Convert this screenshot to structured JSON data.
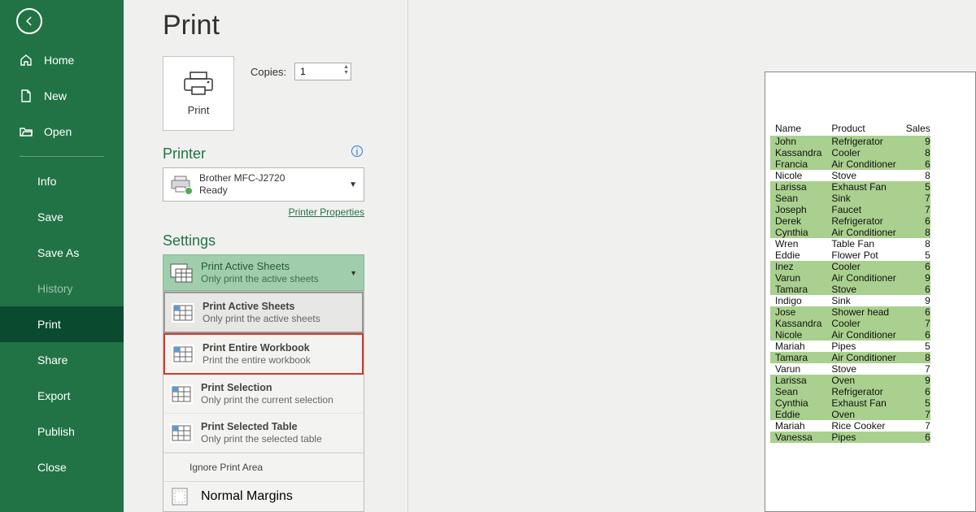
{
  "page_title": "Print",
  "sidebar": {
    "items": [
      {
        "label": "Home",
        "icon": "home"
      },
      {
        "label": "New",
        "icon": "new"
      },
      {
        "label": "Open",
        "icon": "open"
      }
    ],
    "secondary": [
      {
        "label": "Info"
      },
      {
        "label": "Save"
      },
      {
        "label": "Save As"
      },
      {
        "label": "History",
        "disabled": true
      },
      {
        "label": "Print",
        "selected": true
      },
      {
        "label": "Share"
      },
      {
        "label": "Export"
      },
      {
        "label": "Publish"
      },
      {
        "label": "Close"
      }
    ]
  },
  "print_button_label": "Print",
  "copies": {
    "label": "Copies:",
    "value": "1"
  },
  "printer": {
    "section": "Printer",
    "name": "Brother MFC-J2720",
    "status": "Ready",
    "properties_link": "Printer Properties"
  },
  "settings": {
    "section": "Settings",
    "selected": {
      "title": "Print Active Sheets",
      "sub": "Only print the active sheets"
    },
    "options": [
      {
        "title": "Print Active Sheets",
        "sub": "Only print the active sheets",
        "state": "active"
      },
      {
        "title": "Print Entire Workbook",
        "sub": "Print the entire workbook",
        "state": "highlighted"
      },
      {
        "title": "Print Selection",
        "sub": "Only print the current selection",
        "state": ""
      },
      {
        "title": "Print Selected Table",
        "sub": "Only print the selected table",
        "state": ""
      }
    ],
    "ignore": "Ignore Print Area",
    "margins": "Normal Margins"
  },
  "preview": {
    "headers": [
      "Name",
      "Product",
      "Sales"
    ],
    "rows": [
      {
        "name": "John",
        "product": "Refrigerator",
        "sales": "9",
        "g": true
      },
      {
        "name": "Kassandra",
        "product": "Cooler",
        "sales": "8",
        "g": true
      },
      {
        "name": "Francia",
        "product": "Air Conditioner",
        "sales": "6",
        "g": true
      },
      {
        "name": "Nicole",
        "product": "Stove",
        "sales": "8",
        "g": false
      },
      {
        "name": "Larissa",
        "product": "Exhaust Fan",
        "sales": "5",
        "g": true
      },
      {
        "name": "Sean",
        "product": "Sink",
        "sales": "7",
        "g": true
      },
      {
        "name": "Joseph",
        "product": "Faucet",
        "sales": "7",
        "g": true
      },
      {
        "name": "Derek",
        "product": "Refrigerator",
        "sales": "6",
        "g": true
      },
      {
        "name": "Cynthia",
        "product": "Air Conditioner",
        "sales": "8",
        "g": true
      },
      {
        "name": "Wren",
        "product": "Table Fan",
        "sales": "8",
        "g": false
      },
      {
        "name": "Eddie",
        "product": "Flower Pot",
        "sales": "5",
        "g": false
      },
      {
        "name": "Inez",
        "product": "Cooler",
        "sales": "6",
        "g": true
      },
      {
        "name": "Varun",
        "product": "Air Conditioner",
        "sales": "9",
        "g": true
      },
      {
        "name": "Tamara",
        "product": "Stove",
        "sales": "6",
        "g": true
      },
      {
        "name": "Indigo",
        "product": "Sink",
        "sales": "9",
        "g": false
      },
      {
        "name": "Jose",
        "product": "Shower head",
        "sales": "6",
        "g": true
      },
      {
        "name": "Kassandra",
        "product": "Cooler",
        "sales": "7",
        "g": true
      },
      {
        "name": "Nicole",
        "product": "Air Conditioner",
        "sales": "6",
        "g": true
      },
      {
        "name": "Mariah",
        "product": "Pipes",
        "sales": "5",
        "g": false
      },
      {
        "name": "Tamara",
        "product": "Air Conditioner",
        "sales": "8",
        "g": true
      },
      {
        "name": "Varun",
        "product": "Stove",
        "sales": "7",
        "g": false
      },
      {
        "name": "Larissa",
        "product": "Oven",
        "sales": "9",
        "g": true
      },
      {
        "name": "Sean",
        "product": "Refrigerator",
        "sales": "6",
        "g": true
      },
      {
        "name": "Cynthia",
        "product": "Exhaust Fan",
        "sales": "5",
        "g": true
      },
      {
        "name": "Eddie",
        "product": "Oven",
        "sales": "7",
        "g": true
      },
      {
        "name": "Mariah",
        "product": "Rice Cooker",
        "sales": "7",
        "g": false
      },
      {
        "name": "Vanessa",
        "product": "Pipes",
        "sales": "6",
        "g": true
      }
    ]
  }
}
